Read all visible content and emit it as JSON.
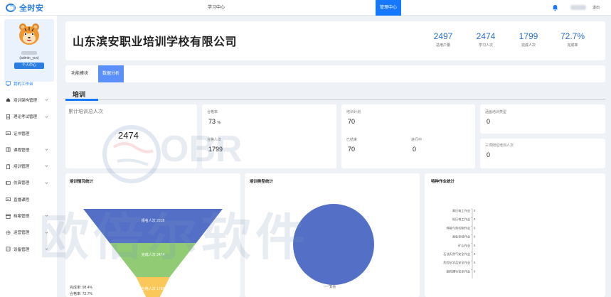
{
  "app": {
    "brand": "全时安"
  },
  "nav": {
    "items": [
      {
        "label": "学习中心",
        "active": false
      },
      {
        "label": "管理中心",
        "active": true
      }
    ],
    "logout": "退出"
  },
  "profile": {
    "username": "(admin_ycx)",
    "button": "个人中心"
  },
  "sidebar": {
    "items": [
      {
        "label": "我的工作台",
        "icon": "monitor-icon",
        "active": true,
        "has_children": false
      },
      {
        "label": "培训架构管理",
        "icon": "home-icon",
        "active": false,
        "has_children": true
      },
      {
        "label": "理论考试管理",
        "icon": "exam-icon",
        "active": false,
        "has_children": true
      },
      {
        "label": "证书管理",
        "icon": "certificate-icon",
        "active": false,
        "has_children": false
      },
      {
        "label": "课程管理",
        "icon": "book-icon",
        "active": false,
        "has_children": true
      },
      {
        "label": "培训管理",
        "icon": "clipboard-icon",
        "active": false,
        "has_children": true
      },
      {
        "label": "仿真管理",
        "icon": "simulation-icon",
        "active": false,
        "has_children": true
      },
      {
        "label": "直播课程",
        "icon": "live-icon",
        "active": false,
        "has_children": false
      },
      {
        "label": "档案管理",
        "icon": "archive-icon",
        "active": false,
        "has_children": true
      },
      {
        "label": "运营管理",
        "icon": "gear-icon",
        "active": false,
        "has_children": true
      },
      {
        "label": "设备管理",
        "icon": "device-icon",
        "active": false,
        "has_children": true
      }
    ]
  },
  "header": {
    "company": "山东滨安职业培训学校有限公司",
    "kpis": [
      {
        "value": "2497",
        "label": "总用户量"
      },
      {
        "value": "2474",
        "label": "学习人次"
      },
      {
        "value": "1799",
        "label": "完成人次"
      },
      {
        "value": "72.7%",
        "label": "完成率"
      }
    ]
  },
  "tabs": [
    {
      "label": "功能模块",
      "active": false
    },
    {
      "label": "数据分析",
      "active": true
    }
  ],
  "section": {
    "title": "培训"
  },
  "stats": {
    "total": {
      "label": "累计培训总人次",
      "value": "2474"
    },
    "pass": {
      "rate_label": "合格率",
      "rate_value": "73",
      "rate_unit": "%",
      "count_label": "合格人次",
      "count_value": "1799"
    },
    "plan": {
      "label": "培训计划",
      "value": "70",
      "done_label": "已结束",
      "done_value": "70",
      "ongoing_label": "进行中",
      "ongoing_value": "0"
    },
    "types": {
      "label": "涵盖培训类型",
      "value": "0",
      "three_label": "三项岗位培训人次",
      "three_value": "0"
    }
  },
  "panels": {
    "funnel": {
      "title": "培训情况统计"
    },
    "pie": {
      "title": "培训类型统计"
    },
    "special": {
      "title": "特种作业统计"
    }
  },
  "funnel_summary": {
    "complete_label": "完成率:",
    "complete_value": "98.4%",
    "pass_label": "合格率:",
    "pass_value": "72.7%"
  },
  "chart_data": [
    {
      "type": "funnel",
      "title": "培训情况统计",
      "categories": [
        "报名人次",
        "完成人次",
        "合格人次"
      ],
      "values": [
        2318,
        2474,
        1799
      ],
      "colors": [
        "#5470c6",
        "#91cc75",
        "#fac858"
      ]
    },
    {
      "type": "pie",
      "title": "培训类型统计",
      "categories": [
        "其他"
      ],
      "values": [
        100
      ],
      "colors": [
        "#5470c6"
      ]
    },
    {
      "type": "bar",
      "title": "特种作业统计",
      "orientation": "horizontal",
      "categories": [
        "高压电工作业",
        "低压电工作业",
        "焊接与热切割作业",
        "高处安装作业",
        "矿山作业",
        "石油天然气安全作业",
        "危险化学品安全作业",
        "烟花爆竹安全作业"
      ],
      "values": [
        0,
        0,
        0,
        0,
        0,
        0,
        0,
        0
      ]
    }
  ],
  "watermark": {
    "line1": "OBR",
    "line2": "欧倍尔软件"
  },
  "colors": {
    "primary": "#1677ff",
    "kpi": "#2a6fc9",
    "funnel_1": "#5470c6",
    "funnel_2": "#91cc75",
    "funnel_3": "#fac858",
    "pie": "#5470c6"
  }
}
